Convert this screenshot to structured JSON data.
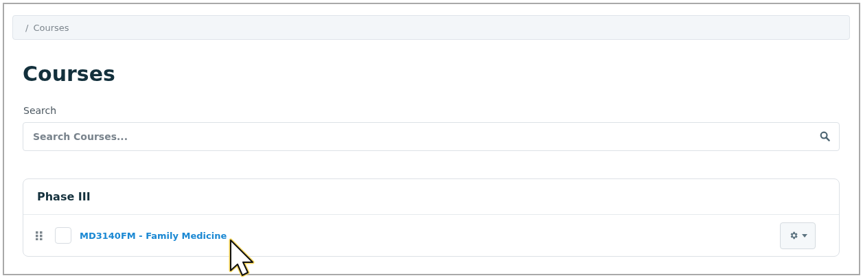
{
  "breadcrumb": {
    "separator": "/",
    "current": "Courses"
  },
  "title": "Courses",
  "search": {
    "label": "Search",
    "placeholder": "Search Courses..."
  },
  "groups": [
    {
      "name": "Phase III",
      "courses": [
        {
          "label": "MD3140FM - Family Medicine",
          "checked": false
        }
      ]
    }
  ]
}
